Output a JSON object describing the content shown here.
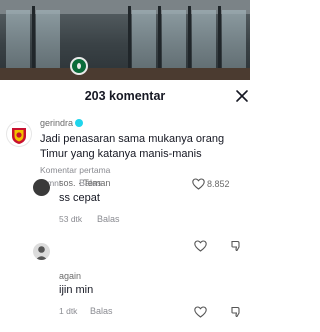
{
  "header": {
    "title": "203 komentar"
  },
  "comments": [
    {
      "username": "gerindra",
      "text": "Jadi penasaran sama mukanya orang Timur yang katanya manis-manis",
      "label": "Komentar pertama",
      "time": "1 mnt",
      "reply_label": "Balas",
      "likes": "8.852"
    },
    {
      "username": "sos.",
      "relation": "· Teman",
      "text": "ss cepat",
      "time": "53 dtk",
      "reply_label": "Balas"
    },
    {
      "username": "again",
      "text": "ijin min",
      "time": "1 dtk",
      "reply_label": "Balas"
    }
  ],
  "colors": {
    "verified": "#20d5ec",
    "text": "#161823",
    "muted": "#8a8b91"
  }
}
